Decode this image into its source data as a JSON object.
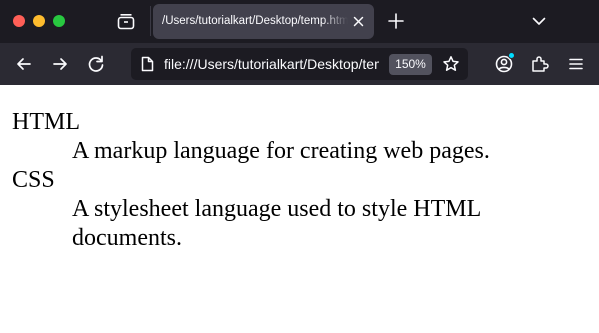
{
  "browser": {
    "tab": {
      "title": "/Users/tutorialkart/Desktop/temp.html"
    },
    "urlbar": {
      "url": "file:///Users/tutorialkart/Desktop/temp.html",
      "zoom": "150%"
    },
    "colors": {
      "tab_strip": "#1c1b22",
      "toolbar": "#2b2a33",
      "active_tab": "#42414d",
      "notification_dot": "#00ddff"
    },
    "icons": {
      "tab_list": "tab-list-icon",
      "close_tab": "close-icon",
      "new_tab": "plus-icon",
      "list_all_tabs": "chevron-down-icon",
      "back": "back-arrow-icon",
      "forward": "forward-arrow-icon",
      "reload": "reload-icon",
      "page": "page-icon",
      "bookmark": "star-icon",
      "account": "account-icon",
      "extensions": "puzzle-icon",
      "menu": "hamburger-menu-icon"
    }
  },
  "page": {
    "definitions": [
      {
        "term": "HTML",
        "description": "A markup language for creating web pages."
      },
      {
        "term": "CSS",
        "description": "A stylesheet language used to style HTML documents."
      }
    ]
  }
}
